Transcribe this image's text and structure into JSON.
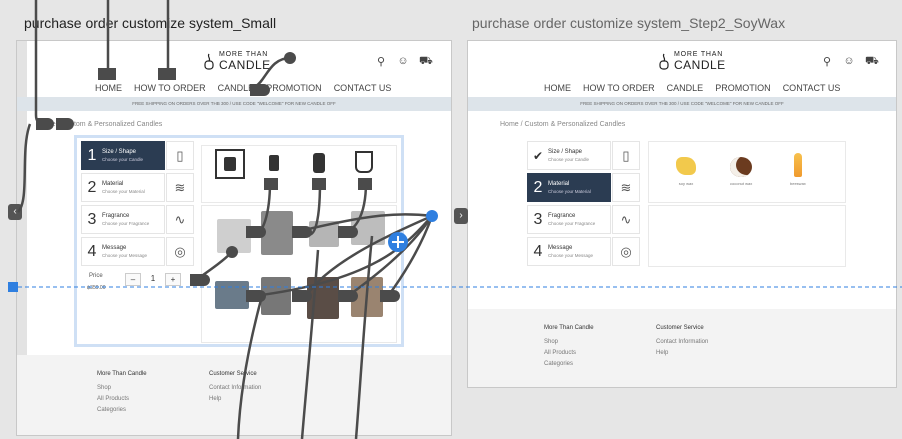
{
  "frames": {
    "small": {
      "title": "purchase order customize system_Small"
    },
    "step2": {
      "title": "purchase order customize system_Step2_SoyWax"
    }
  },
  "site": {
    "logo_top": "MORE THAN",
    "logo_bottom": "CANDLE",
    "nav": [
      "HOME",
      "HOW TO ORDER",
      "CANDLE",
      "PROMOTION",
      "CONTACT US"
    ],
    "promo": "FREE SHIPPING ON ORDERS OVER THB 300 / USE CODE \"WELCOME\" FOR NEW CANDLE OFF",
    "breadcrumb": "Home  /  Custom & Personalized Candles",
    "icons": [
      "search-icon",
      "user-icon",
      "cart-icon"
    ]
  },
  "steps": [
    {
      "num": "1",
      "title": "Size / Shape",
      "sub": "Choose your Candle"
    },
    {
      "num": "2",
      "title": "Material",
      "sub": "Choose your Material"
    },
    {
      "num": "3",
      "title": "Fragrance",
      "sub": "Choose your Fragrance"
    },
    {
      "num": "4",
      "title": "Message",
      "sub": "Choose your Message"
    }
  ],
  "order": {
    "price_label": "Price",
    "price_value": "฿359.00",
    "minus": "–",
    "qty": "1",
    "plus": "+"
  },
  "materials": [
    {
      "label": "soy wax"
    },
    {
      "label": "coconut wax"
    },
    {
      "label": "beeswax"
    }
  ],
  "footer": {
    "col1": {
      "title": "More Than Candle",
      "links": [
        "Shop",
        "All Products",
        "Categories"
      ]
    },
    "col2": {
      "title": "Customer Service",
      "links": [
        "Contact Information",
        "Help"
      ]
    }
  },
  "colors": {
    "accent": "#2b3c52",
    "flow": "#4b4b4b",
    "flow_selected": "#2f7fe0"
  }
}
